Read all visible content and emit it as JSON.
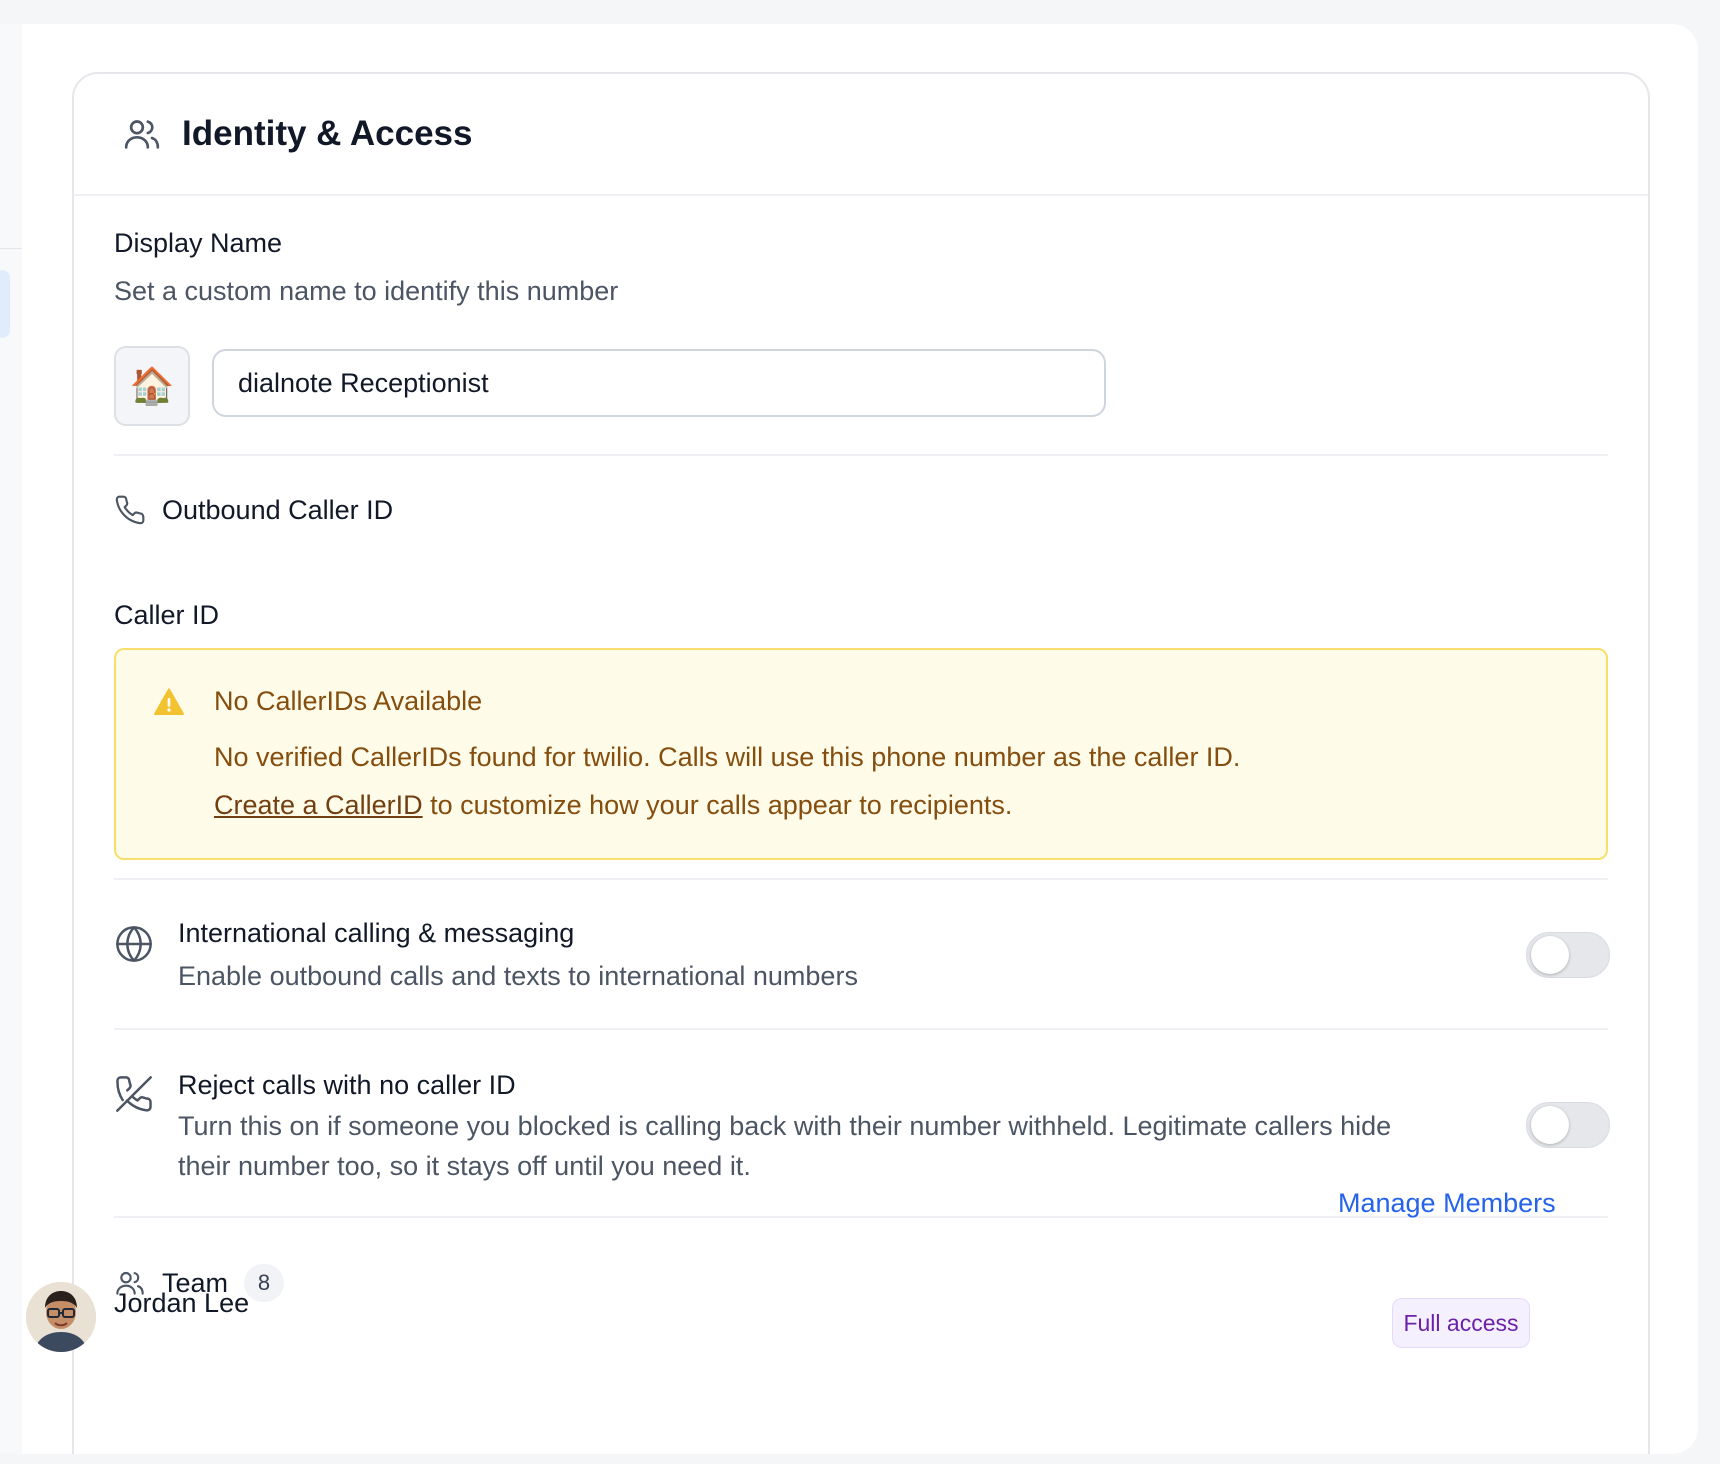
{
  "card": {
    "title": "Identity & Access",
    "icon": "users-icon"
  },
  "display_name": {
    "label": "Display Name",
    "description": "Set a custom name to identify this number",
    "emoji": "🏠",
    "value": "dialnote Receptionist"
  },
  "outbound": {
    "section_label": "Outbound Caller ID",
    "icon": "phone-icon",
    "caller_id_label": "Caller ID"
  },
  "alert": {
    "icon": "warning-icon",
    "title": "No CallerIDs Available",
    "text": "No verified CallerIDs found for twilio. Calls will use this phone number as the caller ID.",
    "link_text": "Create a CallerID",
    "link_suffix": " to customize how your calls appear to recipients."
  },
  "settings": [
    {
      "icon": "globe-icon",
      "title": "International calling & messaging",
      "description": "Enable outbound calls and texts to international numbers",
      "enabled": false
    },
    {
      "icon": "phone-off-icon",
      "title": "Reject calls with no caller ID",
      "description": "Turn this on if someone you blocked is calling back with their number withheld. Legitimate callers hide their number too, so it stays off until you need it.",
      "enabled": false
    }
  ],
  "team": {
    "label": "Team",
    "count": "8",
    "manage_label": "Manage Members",
    "members": [
      {
        "name": "Jordan Lee",
        "access": "Full access"
      }
    ]
  },
  "colors": {
    "accent": "#2563eb",
    "warning_bg": "#fefbe8",
    "warning_text": "#854d0e"
  }
}
